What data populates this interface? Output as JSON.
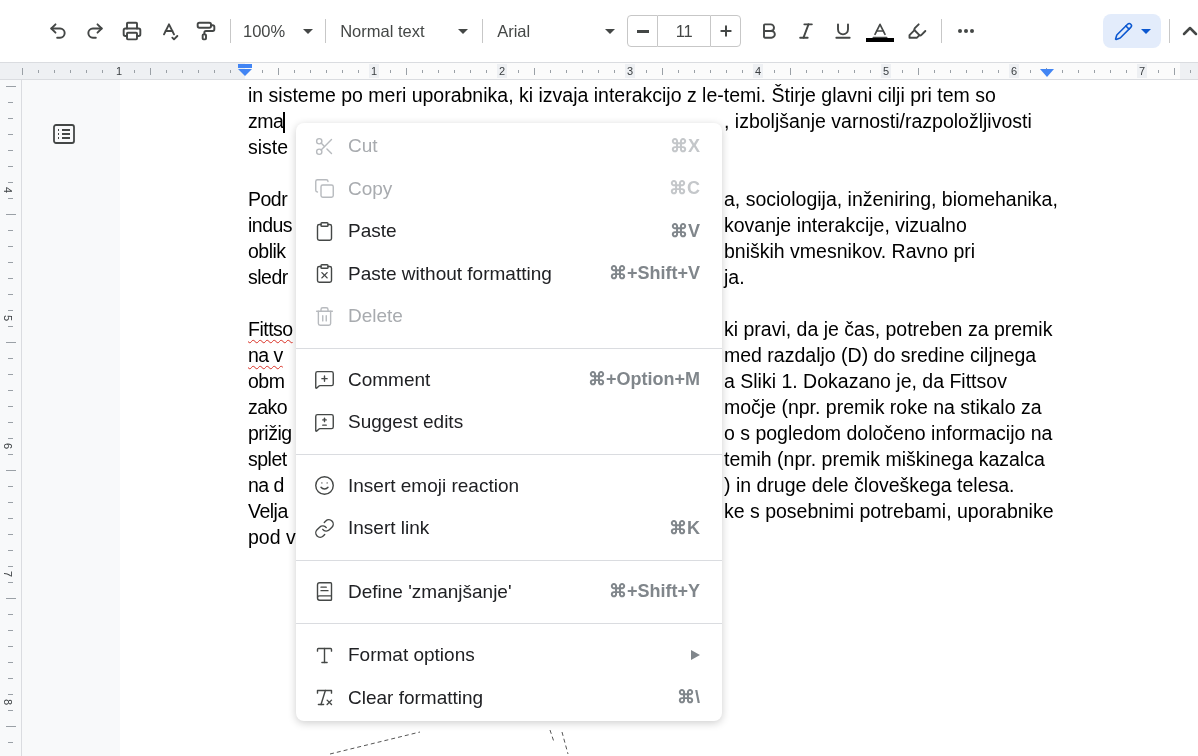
{
  "toolbar": {
    "zoom": "100%",
    "style": "Normal text",
    "font": "Arial",
    "font_size": "11",
    "edit_mode_selected": true
  },
  "ruler": {
    "horizontal": [
      "1",
      "1",
      "2",
      "3",
      "4",
      "5",
      "6",
      "7"
    ],
    "vertical": [
      "4",
      "5",
      "6",
      "7",
      "8"
    ]
  },
  "document": {
    "lines": [
      {
        "kind": "text",
        "left": "in sisteme po meri uporabnika, ki izvaja interakcijo z le-temi. Štirje glavni cilji pri tem so",
        "cursor": false,
        "misspelled": false
      },
      {
        "kind": "text",
        "left": "zma",
        "right": ", izboljšanje varnosti/razpoložljivosti",
        "cursor": true,
        "misspelled": false
      },
      {
        "kind": "text",
        "left": "siste",
        "cursor": false,
        "misspelled": false
      },
      {
        "kind": "gap"
      },
      {
        "kind": "text",
        "left": "Podr",
        "right": "a, sociologija, inženiring, biomehanika,",
        "cursor": false,
        "misspelled": false
      },
      {
        "kind": "text",
        "left": "indus",
        "right": "kovanje interakcije, vizualno",
        "cursor": false,
        "misspelled": false
      },
      {
        "kind": "text",
        "left": "oblik",
        "right": "bniških vmesnikov. Ravno pri",
        "cursor": false,
        "misspelled": false
      },
      {
        "kind": "text",
        "left": "sledr",
        "right": "ja.",
        "cursor": false,
        "misspelled": false
      },
      {
        "kind": "gap"
      },
      {
        "kind": "text",
        "left": "Fittso",
        "right": "ki pravi, da je čas, potreben za premik",
        "cursor": false,
        "misspelled": true
      },
      {
        "kind": "text",
        "left": "na v",
        "right": "med razdaljo (D) do sredine ciljnega",
        "cursor": false,
        "misspelled": true
      },
      {
        "kind": "text",
        "left": "obm",
        "right": "a Sliki 1. Dokazano je, da Fittsov",
        "cursor": false,
        "misspelled": false
      },
      {
        "kind": "text",
        "left": "zako",
        "right": "močje (npr. premik roke na stikalo za",
        "cursor": false,
        "misspelled": false
      },
      {
        "kind": "text",
        "left": "prižig",
        "right": "o s pogledom določeno informacijo na",
        "cursor": false,
        "misspelled": false
      },
      {
        "kind": "text",
        "left": "splet",
        "right": "temih (npr. premik miškinega kazalca",
        "cursor": false,
        "misspelled": false
      },
      {
        "kind": "text",
        "left": "na d",
        "right": ") in druge dele človeškega telesa.",
        "cursor": false,
        "misspelled": false
      },
      {
        "kind": "text",
        "left": "Velja",
        "right": "ke s posebnimi potrebami, uporabnike",
        "cursor": false,
        "misspelled": false
      },
      {
        "kind": "text",
        "left": "pod v",
        "cursor": false,
        "misspelled": false
      }
    ]
  },
  "context_menu": [
    {
      "kind": "item",
      "label": "Cut",
      "shortcut": "⌘X",
      "disabled": true,
      "submenu": false
    },
    {
      "kind": "item",
      "label": "Copy",
      "shortcut": "⌘C",
      "disabled": true,
      "submenu": false
    },
    {
      "kind": "item",
      "label": "Paste",
      "shortcut": "⌘V",
      "disabled": false,
      "submenu": false
    },
    {
      "kind": "item",
      "label": "Paste without formatting",
      "shortcut": "⌘+Shift+V",
      "disabled": false,
      "submenu": false
    },
    {
      "kind": "item",
      "label": "Delete",
      "disabled": true,
      "submenu": false
    },
    {
      "kind": "divider"
    },
    {
      "kind": "item",
      "label": "Comment",
      "shortcut": "⌘+Option+M",
      "disabled": false,
      "submenu": false
    },
    {
      "kind": "item",
      "label": "Suggest edits",
      "disabled": false,
      "submenu": false
    },
    {
      "kind": "divider"
    },
    {
      "kind": "item",
      "label": "Insert emoji reaction",
      "disabled": false,
      "submenu": false
    },
    {
      "kind": "item",
      "label": "Insert link",
      "shortcut": "⌘K",
      "disabled": false,
      "submenu": false
    },
    {
      "kind": "divider"
    },
    {
      "kind": "item",
      "label": "Define 'zmanjšanje'",
      "shortcut": "⌘+Shift+Y",
      "disabled": false,
      "submenu": false
    },
    {
      "kind": "divider"
    },
    {
      "kind": "item",
      "label": "Format options",
      "disabled": false,
      "submenu": true
    },
    {
      "kind": "item",
      "label": "Clear formatting",
      "shortcut": "⌘\\",
      "disabled": false,
      "submenu": false
    }
  ]
}
